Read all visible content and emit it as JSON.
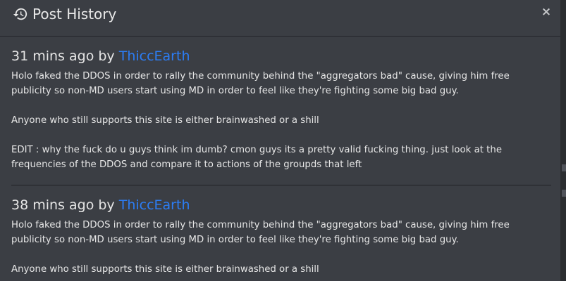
{
  "dialog": {
    "title": "Post History",
    "close_label": "×",
    "history_icon": "history-icon",
    "close_icon": "close-icon"
  },
  "entries": [
    {
      "timestamp": "31 mins ago",
      "by_label": "by",
      "author": "ThiccEarth",
      "paragraphs": [
        "Holo faked the DDOS in order to rally the community behind the \"aggregators bad\" cause, giving him free publicity so non-MD users start using MD in order to feel like they're fighting some big bad guy.",
        "Anyone who still supports this site is either brainwashed or a shill",
        "EDIT : why the fuck do u guys think im dumb? cmon guys its a pretty valid fucking thing. just look at the frequencies of the DDOS and compare it to actions of the groupds that left"
      ]
    },
    {
      "timestamp": "38 mins ago",
      "by_label": "by",
      "author": "ThiccEarth",
      "paragraphs": [
        "Holo faked the DDOS in order to rally the community behind the \"aggregators bad\" cause, giving him free publicity so non-MD users start using MD in order to feel like they're fighting some big bad guy.",
        "Anyone who still supports this site is either brainwashed or a shill"
      ]
    }
  ],
  "colors": {
    "background": "#3b3e44",
    "text": "#e6e6e6",
    "link": "#2c7df5",
    "divider": "#1f2125"
  }
}
